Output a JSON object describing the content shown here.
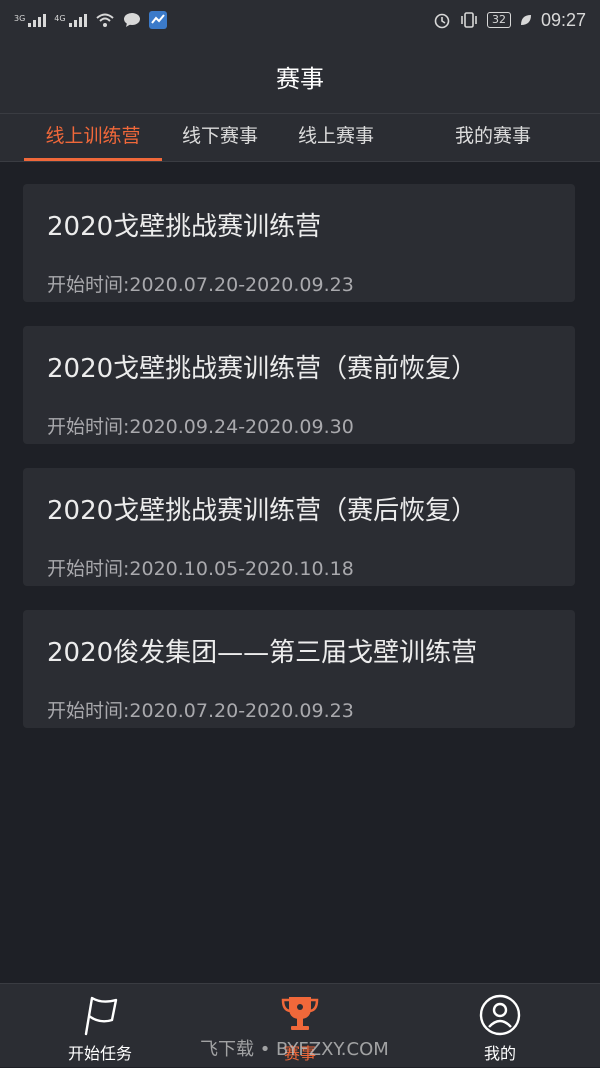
{
  "status_bar": {
    "network1": "3G",
    "network2": "4G",
    "battery": "32",
    "time": "09:27"
  },
  "header": {
    "title": "赛事"
  },
  "tabs": [
    {
      "label": "线上训练营",
      "active": true
    },
    {
      "label": "线下赛事",
      "active": false
    },
    {
      "label": "线上赛事",
      "active": false
    },
    {
      "label": "我的赛事",
      "active": false
    }
  ],
  "events": [
    {
      "title": "2020戈壁挑战赛训练营",
      "date": "开始时间:2020.07.20-2020.09.23"
    },
    {
      "title": "2020戈壁挑战赛训练营（赛前恢复）",
      "date": "开始时间:2020.09.24-2020.09.30"
    },
    {
      "title": "2020戈壁挑战赛训练营（赛后恢复）",
      "date": "开始时间:2020.10.05-2020.10.18"
    },
    {
      "title": "2020俊发集团——第三届戈壁训练营",
      "date": "开始时间:2020.07.20-2020.09.23"
    }
  ],
  "bottom_nav": [
    {
      "label": "开始任务",
      "icon": "flag-icon"
    },
    {
      "label": "赛事",
      "icon": "trophy-icon",
      "active": true
    },
    {
      "label": "我的",
      "icon": "user-icon"
    }
  ],
  "watermark": "飞下载 • BYFZXY.COM",
  "colors": {
    "accent": "#f0683a",
    "background": "#1e2026",
    "card": "#2b2d33"
  }
}
